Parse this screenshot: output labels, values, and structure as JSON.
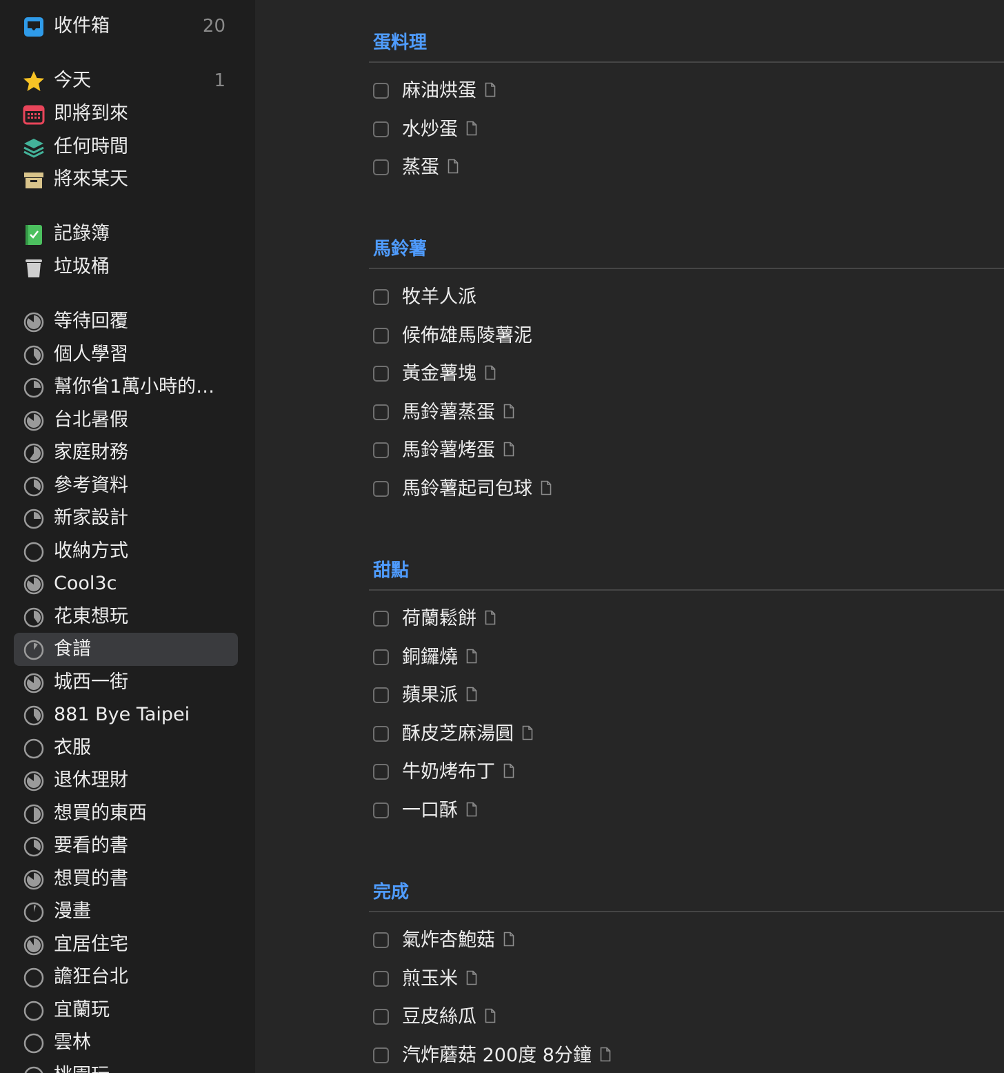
{
  "sidebar": {
    "inbox": {
      "label": "收件箱",
      "count": "20"
    },
    "today": {
      "label": "今天",
      "count": "1"
    },
    "upcoming": {
      "label": "即將到來"
    },
    "anytime": {
      "label": "任何時間"
    },
    "someday": {
      "label": "將來某天"
    },
    "logbook": {
      "label": "記錄簿"
    },
    "trash": {
      "label": "垃圾桶"
    },
    "projects": [
      {
        "label": "等待回覆",
        "progress": 0.85
      },
      {
        "label": "個人學習",
        "progress": 0.4
      },
      {
        "label": "幫你省1萬小時的…",
        "progress": 0.25
      },
      {
        "label": "台北暑假",
        "progress": 0.85
      },
      {
        "label": "家庭財務",
        "progress": 0.6
      },
      {
        "label": "參考資料",
        "progress": 0.35
      },
      {
        "label": "新家設計",
        "progress": 0.25
      },
      {
        "label": "收納方式",
        "progress": 0.0
      },
      {
        "label": "Cool3c",
        "progress": 0.85
      },
      {
        "label": "花東想玩",
        "progress": 0.4
      },
      {
        "label": "食譜",
        "progress": 0.1,
        "selected": true
      },
      {
        "label": "城西一街",
        "progress": 0.85
      },
      {
        "label": "881 Bye Taipei",
        "progress": 0.4
      },
      {
        "label": "衣服",
        "progress": 0.0
      },
      {
        "label": "退休理財",
        "progress": 0.85
      },
      {
        "label": "想買的東西",
        "progress": 0.5
      },
      {
        "label": "要看的書",
        "progress": 0.35
      },
      {
        "label": "想買的書",
        "progress": 0.85
      },
      {
        "label": "漫畫",
        "progress": 0.05
      },
      {
        "label": "宜居住宅",
        "progress": 0.9
      },
      {
        "label": "譫狂台北",
        "progress": 0.0
      },
      {
        "label": "宜蘭玩",
        "progress": 0.0
      },
      {
        "label": "雲林",
        "progress": 0.0
      },
      {
        "label": "桃園玩",
        "progress": 0.0
      }
    ]
  },
  "main": {
    "sections": [
      {
        "title": "蛋料理",
        "tasks": [
          {
            "title": "麻油烘蛋",
            "has_note": true
          },
          {
            "title": "水炒蛋",
            "has_note": true
          },
          {
            "title": "蒸蛋",
            "has_note": true
          }
        ]
      },
      {
        "title": "馬鈴薯",
        "tasks": [
          {
            "title": "牧羊人派",
            "has_note": false
          },
          {
            "title": "候佈雄馬陵薯泥",
            "has_note": false
          },
          {
            "title": "黃金薯塊",
            "has_note": true
          },
          {
            "title": "馬鈴薯蒸蛋",
            "has_note": true
          },
          {
            "title": "馬鈴薯烤蛋",
            "has_note": true
          },
          {
            "title": "馬鈴薯起司包球",
            "has_note": true
          }
        ]
      },
      {
        "title": "甜點",
        "tasks": [
          {
            "title": "荷蘭鬆餅",
            "has_note": true
          },
          {
            "title": "銅鑼燒",
            "has_note": true
          },
          {
            "title": "蘋果派",
            "has_note": true
          },
          {
            "title": "酥皮芝麻湯圓",
            "has_note": true
          },
          {
            "title": "牛奶烤布丁",
            "has_note": true
          },
          {
            "title": "一口酥",
            "has_note": true
          }
        ]
      },
      {
        "title": "完成",
        "tasks": [
          {
            "title": "氣炸杏鮑菇",
            "has_note": true
          },
          {
            "title": "煎玉米",
            "has_note": true
          },
          {
            "title": "豆皮絲瓜",
            "has_note": true
          },
          {
            "title": "汽炸蘑菇 200度 8分鐘",
            "has_note": true
          }
        ]
      }
    ]
  },
  "colors": {
    "sidebar_bg": "#1e1e1e",
    "main_bg": "#262626",
    "section_title": "#4f9cff",
    "selected_bg": "#3a3b3e",
    "today_star": "#f7c325",
    "upcoming": "#e8455a",
    "anytime": "#43b39a",
    "someday": "#d9c48b",
    "logbook": "#4cc05f"
  }
}
